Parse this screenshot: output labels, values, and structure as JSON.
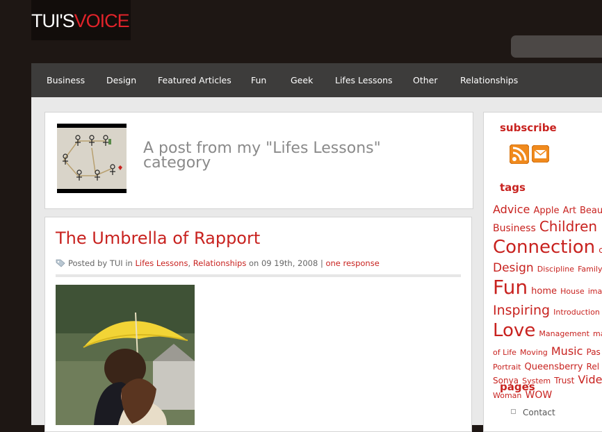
{
  "site": {
    "logo_part1": "TUI'S",
    "logo_part2": "VOICE"
  },
  "search": {
    "placeholder": ""
  },
  "nav": {
    "items": [
      "Business",
      "Design",
      "Featured Articles",
      "Fun",
      "Geek",
      "Lifes Lessons",
      "Other",
      "Relationships"
    ]
  },
  "category_banner": {
    "text": "A post from my \"Lifes Lessons\" category"
  },
  "post": {
    "title": "The Umbrella of Rapport",
    "posted_by_prefix": "Posted by",
    "author": "TUI",
    "in_word": "in",
    "category1": "Lifes Lessons",
    "comma": ",",
    "category2": "Relationships",
    "on_date": "on 09 19th, 2008",
    "separator": "|",
    "response": "one response"
  },
  "sidebar": {
    "subscribe_heading": "subscribe",
    "tags_heading": "tags",
    "pages_heading": "pages",
    "pages": [
      "Contact"
    ],
    "tag_lines": [
      [
        [
          "Advice",
          16
        ],
        [
          "Apple",
          13
        ],
        [
          "Art",
          13
        ],
        [
          "Beaut",
          13
        ]
      ],
      [
        [
          "Business",
          14
        ],
        [
          "Children",
          20
        ]
      ],
      [
        [
          "Connection",
          26
        ],
        [
          "co",
          12
        ]
      ],
      [
        [
          "Design",
          17
        ],
        [
          "Discipline",
          11
        ],
        [
          "Family",
          11
        ]
      ],
      [
        [
          "Fun",
          28
        ],
        [
          "home",
          13
        ],
        [
          "House",
          11
        ],
        [
          "imag",
          11
        ]
      ],
      [
        [
          "Inspiring",
          19
        ],
        [
          "Introduction",
          11
        ]
      ],
      [
        [
          "Love",
          26
        ],
        [
          "Management",
          11
        ],
        [
          "ma",
          11
        ]
      ],
      [
        [
          "of Life",
          11
        ],
        [
          "Moving",
          11
        ],
        [
          "Music",
          16
        ],
        [
          "Pas",
          12
        ]
      ],
      [
        [
          "Portrait",
          11
        ],
        [
          "Queensberry",
          13
        ],
        [
          "Rel",
          12
        ]
      ],
      [
        [
          "Sonya",
          12
        ],
        [
          "System",
          11
        ],
        [
          "Trust",
          12
        ],
        [
          "Vide",
          16
        ]
      ],
      [
        [
          "Woman",
          11
        ],
        [
          "WOW",
          14
        ]
      ]
    ]
  },
  "colors": {
    "accent": "#c8221f",
    "nav_bg": "#3d3c3b",
    "header_bg": "#1e1714"
  }
}
